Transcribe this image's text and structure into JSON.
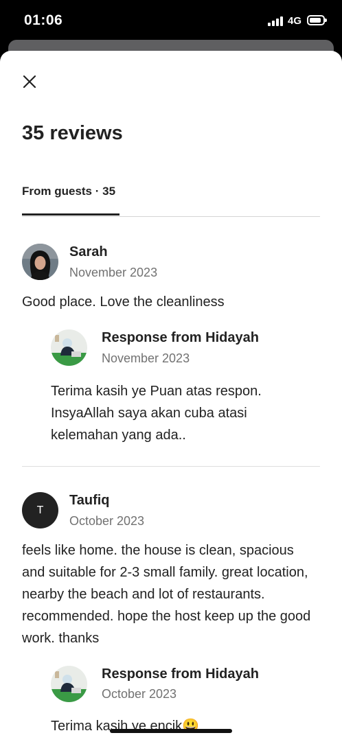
{
  "status_bar": {
    "time": "01:06",
    "network": "4G"
  },
  "header": {
    "title": "35 reviews"
  },
  "tabs": [
    {
      "label": "From guests · 35",
      "active": true
    }
  ],
  "reviews": [
    {
      "author": "Sarah",
      "avatar": "photo",
      "date": "November 2023",
      "text": "Good place. Love the cleanliness",
      "response": {
        "title": "Response from Hidayah",
        "date": "November 2023",
        "text": "Terima kasih ye Puan atas respon. InsyaAllah saya akan cuba atasi kelemahan yang ada.."
      }
    },
    {
      "author": "Taufiq",
      "avatar_initial": "T",
      "date": "October 2023",
      "text": "feels like home. the house is clean, spacious and suitable for 2-3 small family. great location, nearby the beach and lot of restaurants. recommended. hope the host keep up the good work. thanks",
      "response": {
        "title": "Response from Hidayah",
        "date": "October 2023",
        "text": "Terima kasih ye encik😃"
      }
    }
  ],
  "colors": {
    "text": "#222222",
    "muted": "#717171",
    "divider": "#dddddd"
  },
  "icons": [
    "close-icon",
    "signal-icon",
    "battery-icon"
  ]
}
